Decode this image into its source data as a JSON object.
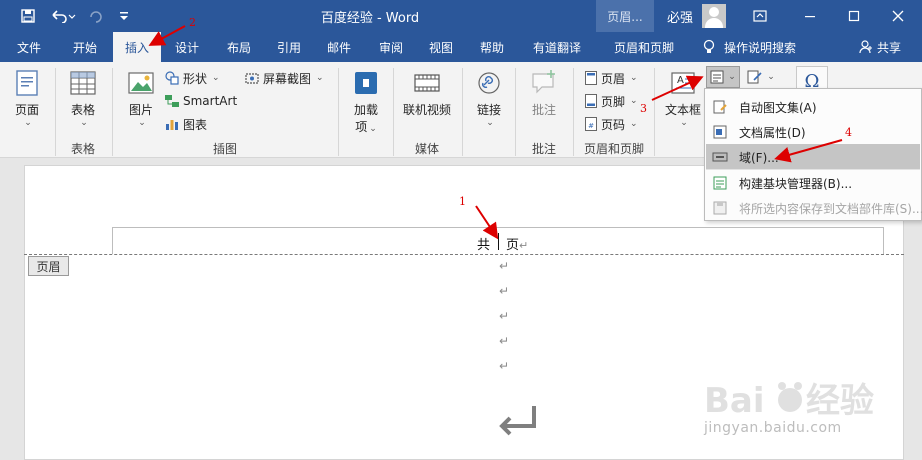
{
  "titlebar": {
    "title": "百度经验 - Word",
    "context_tab": "页眉...",
    "user": "必强",
    "icons": [
      "save-icon",
      "undo-icon",
      "redo-icon",
      "customize-icon",
      "ribbon-display-icon",
      "minimize-icon",
      "maximize-icon",
      "close-icon"
    ]
  },
  "tabs": [
    {
      "label": "文件"
    },
    {
      "label": "开始"
    },
    {
      "label": "插入",
      "active": true
    },
    {
      "label": "设计"
    },
    {
      "label": "布局"
    },
    {
      "label": "引用"
    },
    {
      "label": "邮件"
    },
    {
      "label": "审阅"
    },
    {
      "label": "视图"
    },
    {
      "label": "帮助"
    },
    {
      "label": "有道翻译"
    },
    {
      "label": "页眉和页脚"
    }
  ],
  "tellme": "操作说明搜索",
  "share": "共享",
  "ribbon": {
    "pages": {
      "label": "页面",
      "group": ""
    },
    "table": {
      "label": "表格",
      "group": "表格"
    },
    "picture": {
      "label": "图片"
    },
    "shapes": {
      "label": "形状"
    },
    "smartart": {
      "label": "SmartArt"
    },
    "chart": {
      "label": "图表"
    },
    "screenshot": {
      "label": "屏幕截图"
    },
    "illustrations_group": "插图",
    "addins": {
      "label1": "加载",
      "label2": "项"
    },
    "online_video": {
      "label": "联机视频"
    },
    "media_group": "媒体",
    "link": {
      "label": "链接"
    },
    "comment": {
      "label": "批注"
    },
    "comments_group": "批注",
    "header": {
      "label": "页眉"
    },
    "footer": {
      "label": "页脚"
    },
    "page_number": {
      "label": "页码"
    },
    "hf_group": "页眉和页脚",
    "textbox": {
      "label": "文本框"
    },
    "symbol_glyph": "Ω"
  },
  "menu": {
    "items": [
      {
        "label": "自动图文集(A)",
        "icon": "autotext-icon"
      },
      {
        "label": "文档属性(D)",
        "icon": "document-property-icon"
      },
      {
        "label": "域(F)...",
        "icon": "field-icon",
        "highlighted": true
      },
      {
        "label": "构建基块管理器(B)...",
        "icon": "building-blocks-icon"
      },
      {
        "label": "将所选内容保存到文档部件库(S)...",
        "icon": "save-selection-icon",
        "disabled": true
      }
    ]
  },
  "document": {
    "header_tag": "页眉",
    "header_text_left": "共",
    "header_text_right": "页",
    "paragraph_mark": "↵"
  },
  "annotations": [
    "1",
    "2",
    "3",
    "4"
  ],
  "watermark": "jingyan.baidu.com",
  "colors": {
    "accent": "#2b579a",
    "annotation": "#dd0000"
  }
}
